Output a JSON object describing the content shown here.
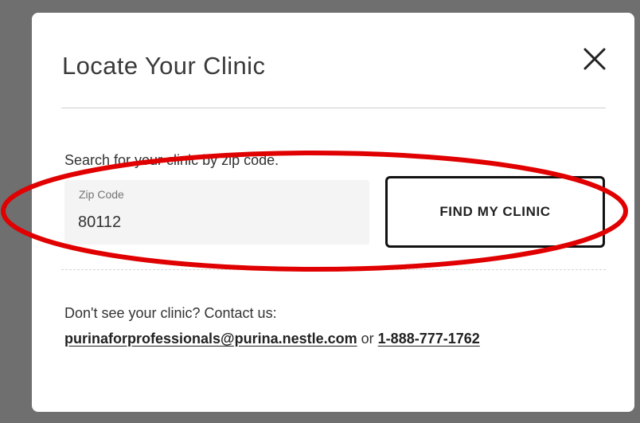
{
  "modal": {
    "title": "Locate Your Clinic",
    "close_icon": "close-icon",
    "prompt": "Search for your clinic by zip code.",
    "zip": {
      "label": "Zip Code",
      "value": "80112"
    },
    "find_button": "FIND MY CLINIC",
    "contact": {
      "lead": "Don't see your clinic? Contact us:",
      "email": "purinaforprofessionals@purina.nestle.com",
      "connector": "or",
      "phone": "1-888-777-1762"
    }
  },
  "annotation": {
    "shape": "red-ellipse",
    "color": "#e00000"
  }
}
